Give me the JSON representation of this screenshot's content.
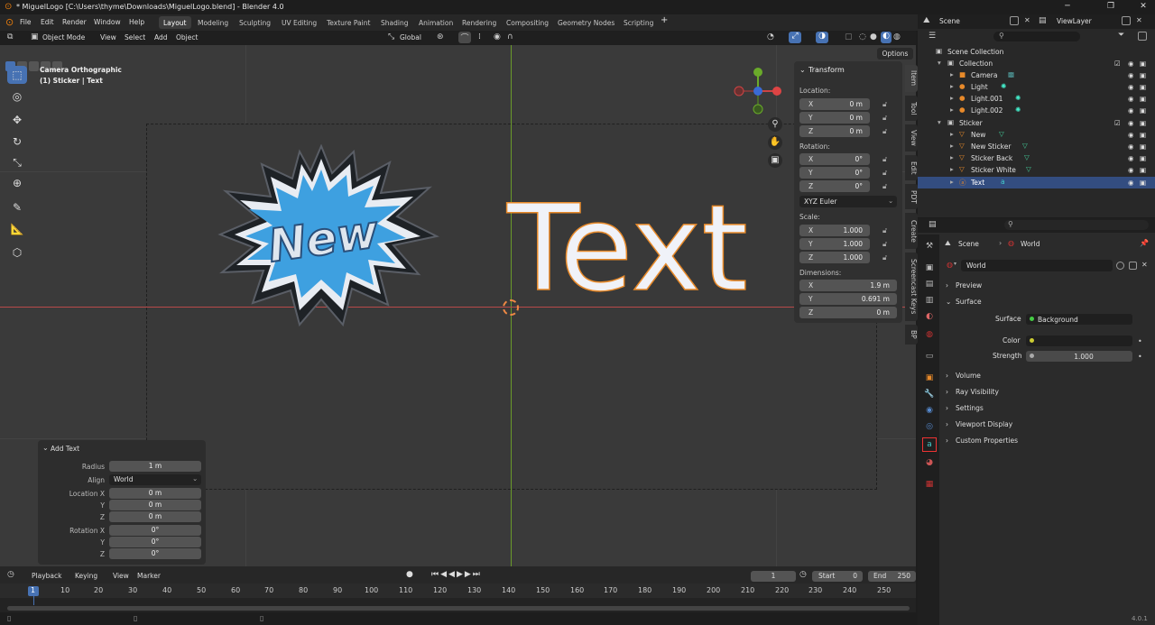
{
  "titlebar": {
    "title": "* MiguelLogo [C:\\Users\\thyme\\Downloads\\MiguelLogo.blend] - Blender 4.0"
  },
  "menus": [
    "File",
    "Edit",
    "Render",
    "Window",
    "Help"
  ],
  "workspaces": [
    "Layout",
    "Modeling",
    "Sculpting",
    "UV Editing",
    "Texture Paint",
    "Shading",
    "Animation",
    "Rendering",
    "Compositing",
    "Geometry Nodes",
    "Scripting"
  ],
  "scene": {
    "label": "Scene",
    "viewlayer": "ViewLayer"
  },
  "viewport_header": {
    "mode": "Object Mode",
    "view": "View",
    "select": "Select",
    "add": "Add",
    "object": "Object",
    "orientation": "Global",
    "options": "Options"
  },
  "overlay_info": {
    "line1": "Camera Orthographic",
    "line2": "(1) Sticker | Text"
  },
  "scene_text": {
    "sticker": "New",
    "text": "Text"
  },
  "npanel": {
    "header": "Transform",
    "location_label": "Location:",
    "location": [
      {
        "axis": "X",
        "value": "0 m"
      },
      {
        "axis": "Y",
        "value": "0 m"
      },
      {
        "axis": "Z",
        "value": "0 m"
      }
    ],
    "rotation_label": "Rotation:",
    "rotation": [
      {
        "axis": "X",
        "value": "0°"
      },
      {
        "axis": "Y",
        "value": "0°"
      },
      {
        "axis": "Z",
        "value": "0°"
      }
    ],
    "rotation_mode": "XYZ Euler",
    "scale_label": "Scale:",
    "scale": [
      {
        "axis": "X",
        "value": "1.000"
      },
      {
        "axis": "Y",
        "value": "1.000"
      },
      {
        "axis": "Z",
        "value": "1.000"
      }
    ],
    "dimensions_label": "Dimensions:",
    "dimensions": [
      {
        "axis": "X",
        "value": "1.9 m"
      },
      {
        "axis": "Y",
        "value": "0.691 m"
      },
      {
        "axis": "Z",
        "value": "0 m"
      }
    ]
  },
  "side_tabs": [
    "Item",
    "Tool",
    "View",
    "Edit",
    "PDT",
    "Create",
    "Screencast Keys",
    "BP"
  ],
  "add_text_panel": {
    "title": "Add Text",
    "fields": [
      {
        "label": "Radius",
        "value": "1 m"
      },
      {
        "label": "Align",
        "value": "World"
      },
      {
        "label": "Location X",
        "value": "0 m"
      },
      {
        "label": "Y",
        "value": "0 m"
      },
      {
        "label": "Z",
        "value": "0 m"
      },
      {
        "label": "Rotation X",
        "value": "0°"
      },
      {
        "label": "Y",
        "value": "0°"
      },
      {
        "label": "Z",
        "value": "0°"
      }
    ]
  },
  "timeline": {
    "playback": "Playback",
    "keying": "Keying",
    "view": "View",
    "marker": "Marker",
    "current_frame": "1",
    "start_label": "Start",
    "start": "0",
    "end_label": "End",
    "end": "250",
    "frames": [
      "1",
      "10",
      "20",
      "30",
      "40",
      "50",
      "60",
      "70",
      "80",
      "90",
      "100",
      "110",
      "120",
      "130",
      "140",
      "150",
      "160",
      "170",
      "180",
      "190",
      "200",
      "210",
      "220",
      "230",
      "240",
      "250"
    ]
  },
  "outliner": {
    "rows": [
      {
        "name": "Scene Collection",
        "indent": 0
      },
      {
        "name": "Collection",
        "indent": 1
      },
      {
        "name": "Camera",
        "indent": 2
      },
      {
        "name": "Light",
        "indent": 2
      },
      {
        "name": "Light.001",
        "indent": 2
      },
      {
        "name": "Light.002",
        "indent": 2
      },
      {
        "name": "Sticker",
        "indent": 1
      },
      {
        "name": "New",
        "indent": 2
      },
      {
        "name": "New Sticker",
        "indent": 2
      },
      {
        "name": "Sticker Back",
        "indent": 2
      },
      {
        "name": "Sticker White",
        "indent": 2
      },
      {
        "name": "Text",
        "indent": 2,
        "selected": true
      }
    ]
  },
  "properties": {
    "breadcrumb_scene": "Scene",
    "breadcrumb_world": "World",
    "world_name": "World",
    "sections": [
      "Preview",
      "Surface",
      "Volume",
      "Ray Visibility",
      "Settings",
      "Viewport Display",
      "Custom Properties"
    ],
    "surface_label": "Surface",
    "surface_value": "Background",
    "color_label": "Color",
    "strength_label": "Strength",
    "strength_value": "1.000"
  },
  "version": "4.0.1",
  "colors": {
    "accent": "#4772b3",
    "selected_row": "#334d80",
    "text_outline": "#e88a2a",
    "sticker_blue": "#3ea0e0"
  }
}
